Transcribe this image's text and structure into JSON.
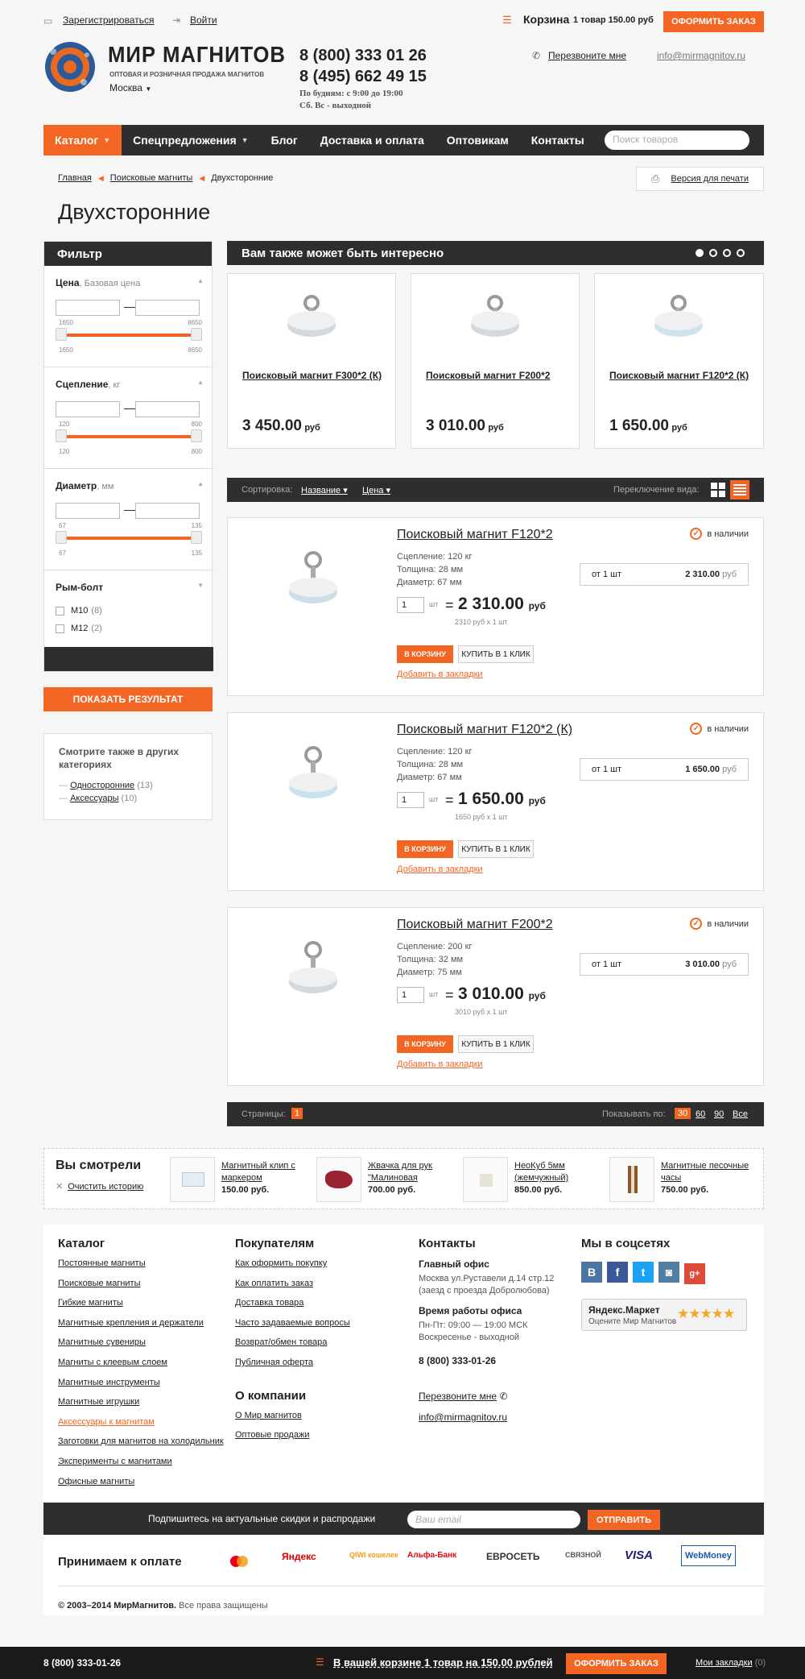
{
  "topbar": {
    "register": "Зарегистрироваться",
    "login": "Войти",
    "cart_label": "Корзина",
    "cart_summary": "1 товар 150.00 руб",
    "order_btn": "ОФОРМИТЬ ЗАКАЗ"
  },
  "header": {
    "logo_title": "МИР МАГНИТОВ",
    "logo_sub": "ОПТОВАЯ И РОЗНИЧНАЯ ПРОДАЖА МАГНИТОВ",
    "city": "Москва",
    "phone1": "8 (800) 333 01 26",
    "phone2": "8 (495) 662 49 15",
    "hours1": "По будням: с 9:00 до 19:00",
    "hours2": "Сб. Вс - выходной",
    "callback": "Перезвоните мне",
    "email": "info@mirmagnitov.ru"
  },
  "nav": {
    "items": [
      "Каталог",
      "Спецпредложения",
      "Блог",
      "Доставка и оплата",
      "Оптовикам",
      "Контакты"
    ],
    "search_placeholder": "Поиск товаров"
  },
  "breadcrumb": {
    "home": "Главная",
    "cat": "Поисковые магниты",
    "current": "Двухсторонние",
    "print": "Версия для печати"
  },
  "page_title": "Двухсторонние",
  "filter": {
    "title": "Фильтр",
    "sections": [
      {
        "name": "Цена",
        "unit": "Базовая цена",
        "min": "1650",
        "max": "8650"
      },
      {
        "name": "Сцепление",
        "unit": "кг",
        "min": "120",
        "max": "800"
      },
      {
        "name": "Диаметр",
        "unit": "мм",
        "min": "67",
        "max": "135"
      }
    ],
    "ring": {
      "name": "Рым-болт",
      "options": [
        {
          "label": "М10",
          "count": "(8)"
        },
        {
          "label": "М12",
          "count": "(2)"
        }
      ]
    },
    "show_btn": "ПОКАЗАТЬ РЕЗУЛЬТАТ"
  },
  "see_also": {
    "title": "Смотрите также в других категориях",
    "items": [
      {
        "label": "Односторонние",
        "count": "(13)"
      },
      {
        "label": "Аксессуары",
        "count": "(10)"
      }
    ]
  },
  "interesting": {
    "title": "Вам также может быть интересно",
    "items": [
      {
        "name": "Поисковый магнит F300*2 (К)",
        "price": "3 450.00",
        "cur": "руб"
      },
      {
        "name": "Поисковый магнит F200*2",
        "price": "3 010.00",
        "cur": "руб"
      },
      {
        "name": "Поисковый магнит F120*2 (К)",
        "price": "1 650.00",
        "cur": "руб"
      }
    ]
  },
  "sortbar": {
    "label": "Сортировка:",
    "by_name": "Название",
    "by_price": "Цена",
    "view": "Переключение вида:"
  },
  "products": [
    {
      "name": "Поисковый магнит F120*2",
      "grip": "Сцепление: 120 кг",
      "thick": "Толщина: 28 мм",
      "diam": "Диаметр: 67 мм",
      "stock": "в наличии",
      "tier_from": "от 1 шт",
      "tier_price": "2 310.00",
      "cur": "руб",
      "qty": "1",
      "unit": "шт",
      "eq": "=",
      "price": "2 310.00",
      "sub": "2310 руб x 1 шт",
      "cart": "В КОРЗИНУ",
      "one": "Купить в 1 клик",
      "bm": "Добавить в закладки"
    },
    {
      "name": "Поисковый магнит F120*2 (К)",
      "grip": "Сцепление: 120 кг",
      "thick": "Толщина: 28 мм",
      "diam": "Диаметр: 67 мм",
      "stock": "в наличии",
      "tier_from": "от 1 шт",
      "tier_price": "1 650.00",
      "cur": "руб",
      "qty": "1",
      "unit": "шт",
      "eq": "=",
      "price": "1 650.00",
      "sub": "1650 руб x 1 шт",
      "cart": "В КОРЗИНУ",
      "one": "Купить в 1 клик",
      "bm": "Добавить в закладки"
    },
    {
      "name": "Поисковый магнит F200*2",
      "grip": "Сцепление: 200 кг",
      "thick": "Толщина: 32 мм",
      "diam": "Диаметр: 75 мм",
      "stock": "в наличии",
      "tier_from": "от 1 шт",
      "tier_price": "3 010.00",
      "cur": "руб",
      "qty": "1",
      "unit": "шт",
      "eq": "=",
      "price": "3 010.00",
      "sub": "3010 руб x 1 шт",
      "cart": "В КОРЗИНУ",
      "one": "Купить в 1 клик",
      "bm": "Добавить в закладки"
    }
  ],
  "pager": {
    "label": "Страницы:",
    "page": "1",
    "show": "Показывать по:",
    "opts": [
      "30",
      "60",
      "90",
      "Все"
    ]
  },
  "viewed": {
    "title": "Вы смотрели",
    "clear": "Очистить историю",
    "items": [
      {
        "name": "Магнитный клип с маркером",
        "price": "150.00 руб."
      },
      {
        "name": "Жвачка для рук \"Малиновая",
        "price": "700.00 руб."
      },
      {
        "name": "НеоКуб 5мм (жемчужный)",
        "price": "850.00 руб."
      },
      {
        "name": "Магнитные песочные часы",
        "price": "750.00 руб."
      }
    ]
  },
  "footer": {
    "catalog": {
      "title": "Каталог",
      "links": [
        "Постоянные магниты",
        "Поисковые магниты",
        "Гибкие магниты",
        "Магнитные крепления и держатели",
        "Магнитные сувениры",
        "Магниты с клеевым слоем",
        "Магнитные инструменты",
        "Магнитные игрушки",
        "Аксессуары к магнитам",
        "Заготовки для магнитов на холодильник",
        "Эксперименты с магнитами",
        "Офисные магниты"
      ]
    },
    "buyers": {
      "title": "Покупателям",
      "links": [
        "Как оформить покупку",
        "Как оплатить заказ",
        "Доставка товара",
        "Часто задаваемые вопросы",
        "Возврат/обмен товара",
        "Публичная оферта"
      ]
    },
    "company": {
      "title": "О компании",
      "links": [
        "О Мир магнитов",
        "Оптовые продажи"
      ]
    },
    "contacts": {
      "title": "Контакты",
      "office": "Главный офис",
      "addr1": "Москва ул.Руставели д.14 стр.12",
      "addr2": "(заезд с проезда Добролюбова)",
      "hours_title": "Время работы офиса",
      "h1": "Пн-Пт: 09:00 — 19:00 МСК",
      "h2": "Воскресенье - выходной",
      "phone": "8 (800) 333-01-26",
      "callback": "Перезвоните мне",
      "email": "info@mirmagnitov.ru"
    },
    "social": {
      "title": "Мы в соцсетях",
      "icons": [
        "В",
        "f",
        "t",
        "◙",
        "g+"
      ],
      "ym_title": "Яндекс.Маркет",
      "ym_sub": "Оцените Мир Магнитов"
    },
    "subscribe": {
      "text": "Подпишитесь на актуальные скидки и распродажи",
      "placeholder": "Ваш email",
      "btn": "ОТПРАВИТЬ"
    },
    "payment": {
      "title": "Принимаем к оплате",
      "logos": [
        "Яндекс",
        "QIWI кошелек",
        "Альфа-Банк",
        "ЕВРОСЕТЬ",
        "СВЯЗНОЙ",
        "VISA",
        "WebMoney"
      ]
    },
    "copy_bold": "© 2003–2014 МирМагнитов.",
    "copy": "Все права защищены"
  },
  "bottombar": {
    "phone": "8 (800) 333-01-26",
    "cart": "В вашей корзине 1 товар на 150.00 рублей",
    "order": "ОФОРМИТЬ ЗАКАЗ",
    "bookmarks": "Мои закладки",
    "bm_count": "(0)"
  }
}
